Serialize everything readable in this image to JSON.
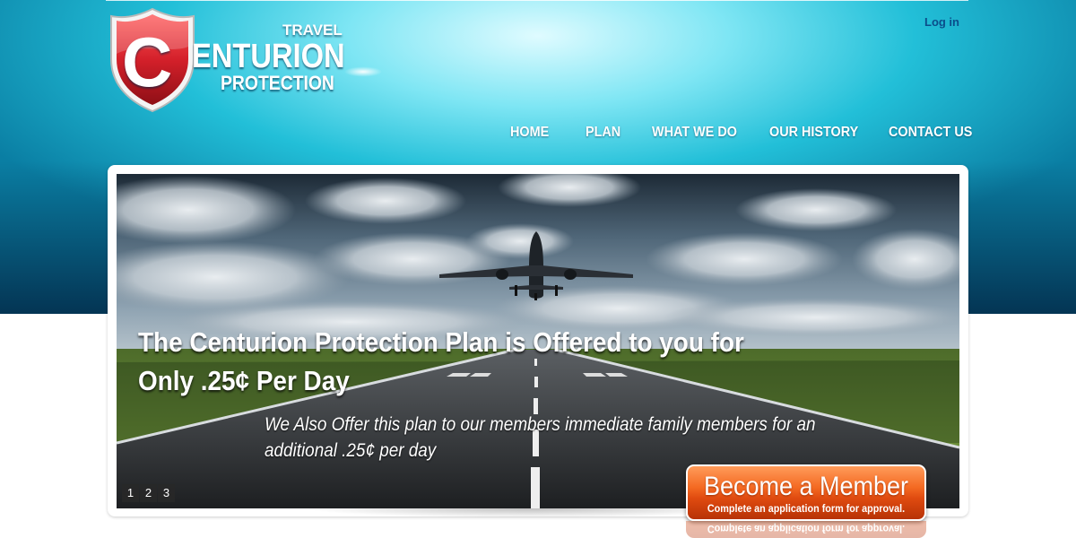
{
  "brand": {
    "logo_letter": "C",
    "logo_line1": "TRAVEL",
    "logo_line2": "ENTURION",
    "logo_line3": "PROTECTION",
    "shield_color": "#d4202a"
  },
  "header": {
    "login_label": "Log in"
  },
  "nav": {
    "items": [
      {
        "label": "HOME"
      },
      {
        "label": "PLAN"
      },
      {
        "label": "WHAT WE DO"
      },
      {
        "label": "OUR HISTORY"
      },
      {
        "label": "CONTACT US"
      }
    ]
  },
  "banner": {
    "headline_line1": "The Centurion Protection Plan is Offered to you for",
    "headline_line2": "Only .25¢ Per Day",
    "subline_line1": "We Also Offer this plan to our members immediate family members for an",
    "subline_line2": "additional .25¢ per day",
    "pages": [
      "1",
      "2",
      "3"
    ]
  },
  "cta": {
    "title": "Become a Member",
    "subtitle": "Complete an  application form for  approval.",
    "color": "#f26522"
  }
}
